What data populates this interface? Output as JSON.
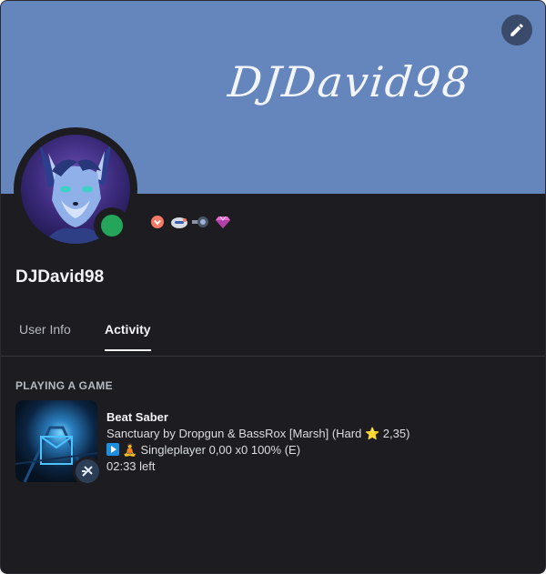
{
  "banner": {
    "text": "DJDavid98",
    "color": "#6585bd"
  },
  "edit_button": {
    "icon": "pencil-icon"
  },
  "profile": {
    "username": "DJDavid98",
    "status": "online",
    "status_color": "#23a55a",
    "badges": [
      "nitro-badge",
      "helmet-badge",
      "orb-badge",
      "gem-badge"
    ]
  },
  "tabs": [
    {
      "label": "User Info",
      "active": false
    },
    {
      "label": "Activity",
      "active": true
    }
  ],
  "activity": {
    "section_title": "PLAYING A GAME",
    "game_name": "Beat Saber",
    "song_line_prefix": "Sanctuary by Dropgun & BassRox [Marsh] (Hard ",
    "star": "⭐",
    "song_line_suffix": "2,35)",
    "mode_emoji": "🧘",
    "mode_text": "Singleplayer 0,00 x0 100% (E)",
    "time_left": "02:33 left"
  }
}
